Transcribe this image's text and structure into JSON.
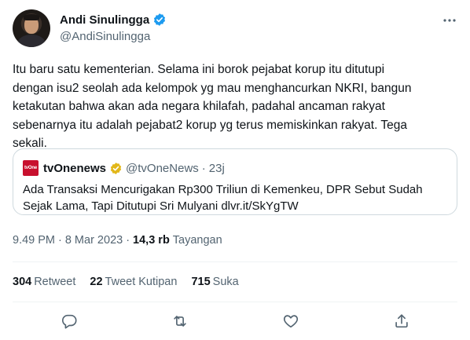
{
  "author": {
    "display_name": "Andi Sinulingga",
    "handle": "@AndiSinulingga",
    "verified": true
  },
  "tweet": {
    "text": "Itu baru satu kementerian. Selama ini borok pejabat korup itu ditutupi\ndengan isu2 seolah ada kelompok yg mau menghancurkan NKRI, bangun\nketakutan bahwa akan ada negara khilafah, padahal ancaman rakyat\nsebenarnya itu adalah pejabat2 korup yg terus memiskinkan rakyat. Tega\nsekali."
  },
  "quote": {
    "logo_text": "tvOne",
    "name": "tvOnenews",
    "handle": "@tvOneNews",
    "separator": "·",
    "time": "23j",
    "text": "Ada Transaksi Mencurigakan Rp300 Triliun di Kemenkeu, DPR Sebut Sudah Sejak Lama, Tapi Ditutupi Sri Mulyani dlvr.it/SkYgTW"
  },
  "meta": {
    "time": "9.49 PM",
    "separator1": "·",
    "date": "8 Mar 2023",
    "separator2": "·",
    "views_count": "14,3 rb",
    "views_label": "Tayangan"
  },
  "stats": {
    "retweets_count": "304",
    "retweets_label": "Retweet",
    "quotes_count": "22",
    "quotes_label": "Tweet Kutipan",
    "likes_count": "715",
    "likes_label": "Suka"
  },
  "colors": {
    "verified_blue": "#1d9bf0",
    "gold_badge": "#e2b719",
    "secondary_text": "#536471",
    "border": "#cfd9de"
  },
  "icons": {
    "reply": "reply-icon",
    "retweet": "retweet-icon",
    "like": "heart-icon",
    "share": "share-icon",
    "more": "more-icon"
  }
}
